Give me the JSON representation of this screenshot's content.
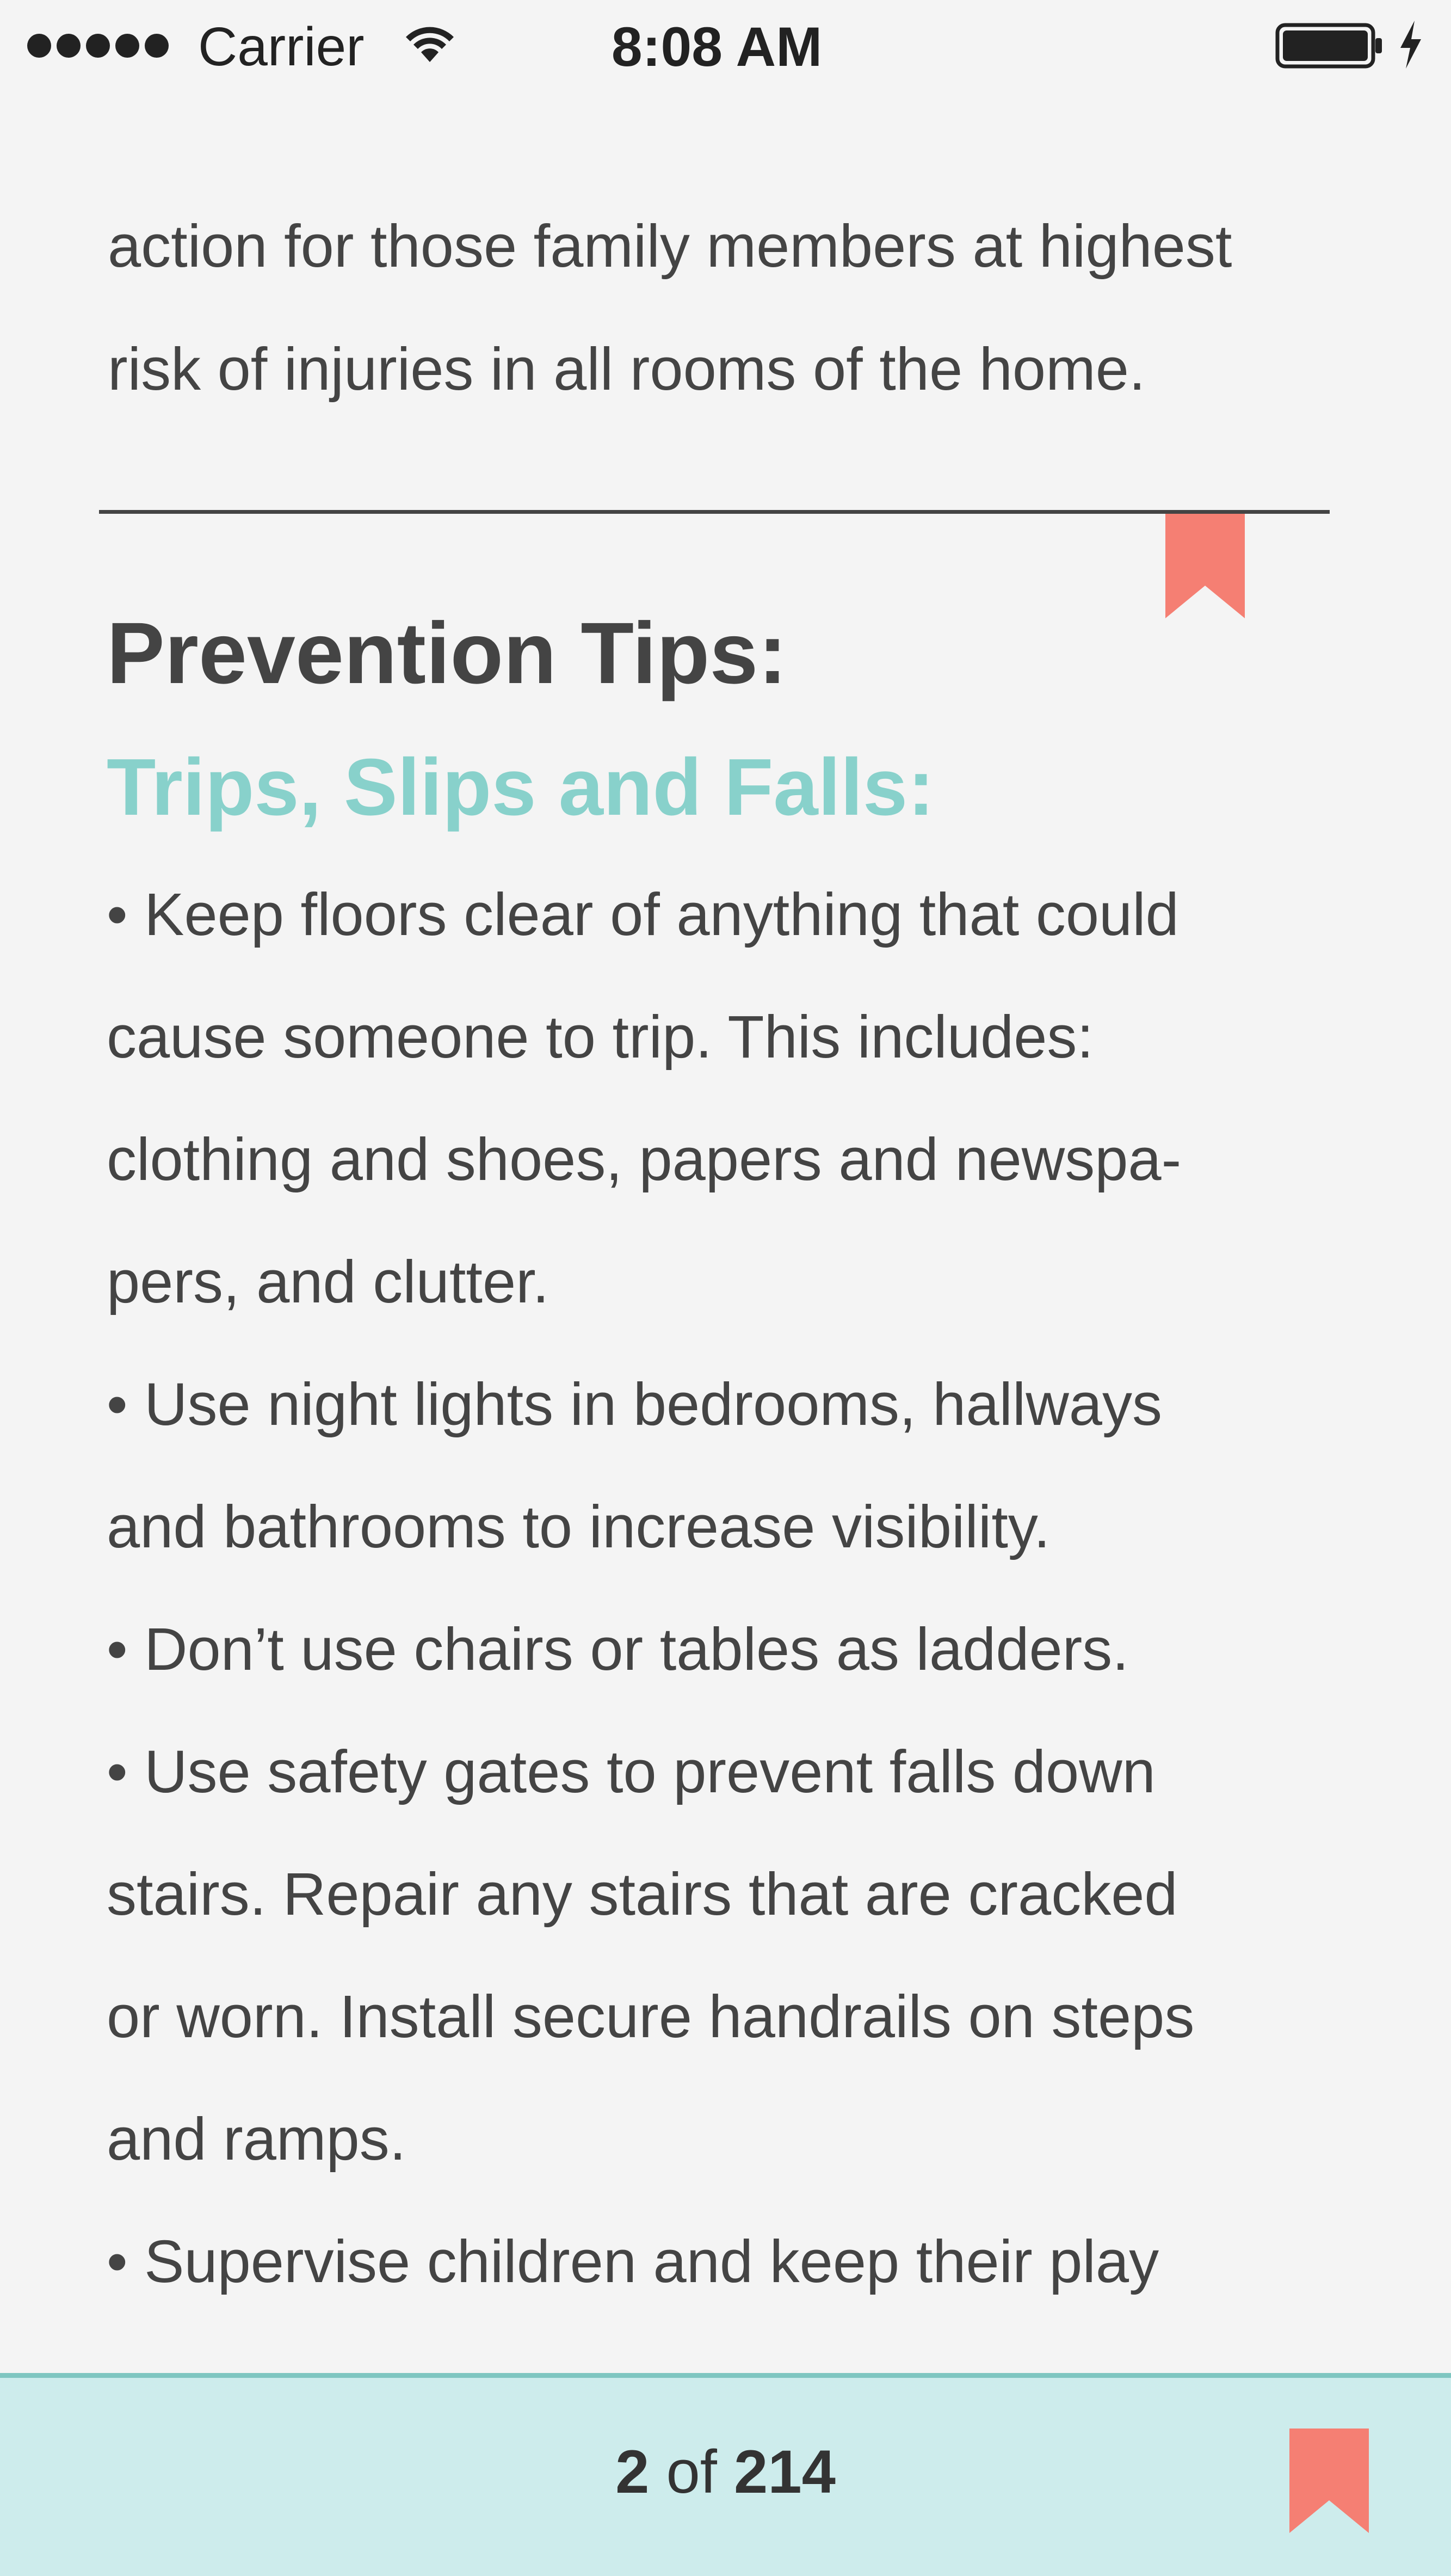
{
  "status_bar": {
    "carrier": "Carrier",
    "time": "8:08 AM",
    "icons": [
      "signal-dots-icon",
      "wifi-icon",
      "battery-icon",
      "charging-bolt-icon"
    ]
  },
  "content": {
    "intro_lines": [
      "action for those family members at highest",
      "risk of injuries in all rooms of the home."
    ],
    "heading": "Prevention Tips:",
    "subheading": "Trips, Slips and Falls:",
    "body_lines": [
      "• Keep floors clear of anything that could",
      "cause someone to trip. This includes:",
      "clothing and shoes, papers and newspa-",
      "pers, and clutter.",
      "• Use night lights in bedrooms, hallways",
      "and bathrooms to increase visibility.",
      "• Don’t use chairs or tables as ladders.",
      "• Use safety gates to prevent falls down",
      "stairs. Repair any stairs that are cracked",
      "or worn. Install secure handrails on steps",
      "and ramps.",
      "• Supervise children and keep their play"
    ]
  },
  "footer": {
    "current_page": "2",
    "of_label": "of",
    "total_pages": "214"
  },
  "colors": {
    "background": "#f4f4f4",
    "text": "#444444",
    "accent_teal": "#88d1cb",
    "bookmark": "#f57f73",
    "footer_bg": "#cdecec",
    "footer_border": "#7fc6c1"
  }
}
